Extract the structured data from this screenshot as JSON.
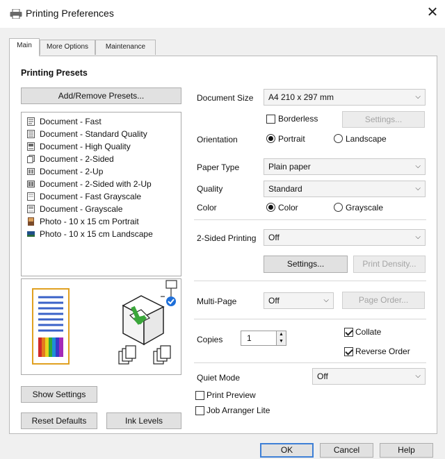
{
  "window": {
    "title": "Printing Preferences",
    "close_glyph": "✕"
  },
  "tabs": [
    {
      "label": "Main",
      "active": true
    },
    {
      "label": "More Options",
      "active": false
    },
    {
      "label": "Maintenance",
      "active": false
    }
  ],
  "presets": {
    "title": "Printing Presets",
    "add_remove_label": "Add/Remove Presets...",
    "items": [
      {
        "label": "Document - Fast",
        "icon": "document-fast-icon"
      },
      {
        "label": "Document - Standard Quality",
        "icon": "document-standard-icon"
      },
      {
        "label": "Document - High Quality",
        "icon": "document-high-quality-icon"
      },
      {
        "label": "Document - 2-Sided",
        "icon": "document-2-sided-icon"
      },
      {
        "label": "Document - 2-Up",
        "icon": "document-2-up-icon"
      },
      {
        "label": "Document - 2-Sided with 2-Up",
        "icon": "document-2-sided-2-up-icon"
      },
      {
        "label": "Document - Fast Grayscale",
        "icon": "document-fast-grayscale-icon"
      },
      {
        "label": "Document - Grayscale",
        "icon": "document-grayscale-icon"
      },
      {
        "label": "Photo - 10 x 15 cm Portrait",
        "icon": "photo-portrait-icon"
      },
      {
        "label": "Photo - 10 x 15 cm Landscape",
        "icon": "photo-landscape-icon"
      }
    ]
  },
  "left_buttons": {
    "show_settings": "Show Settings",
    "reset_defaults": "Reset Defaults",
    "ink_levels": "Ink Levels"
  },
  "settings": {
    "document_size": {
      "label": "Document Size",
      "value": "A4 210 x 297 mm"
    },
    "borderless": {
      "label": "Borderless",
      "checked": false
    },
    "borderless_settings": "Settings...",
    "orientation": {
      "label": "Orientation",
      "options": [
        "Portrait",
        "Landscape"
      ],
      "selected": "Portrait"
    },
    "paper_type": {
      "label": "Paper Type",
      "value": "Plain paper"
    },
    "quality": {
      "label": "Quality",
      "value": "Standard"
    },
    "color": {
      "label": "Color",
      "options": [
        "Color",
        "Grayscale"
      ],
      "selected": "Color"
    },
    "two_sided": {
      "label": "2-Sided Printing",
      "value": "Off"
    },
    "two_sided_settings": "Settings...",
    "print_density": "Print Density...",
    "multi_page": {
      "label": "Multi-Page",
      "value": "Off"
    },
    "page_order": "Page Order...",
    "copies": {
      "label": "Copies",
      "value": "1"
    },
    "collate": {
      "label": "Collate",
      "checked": true
    },
    "reverse_order": {
      "label": "Reverse Order",
      "checked": true
    },
    "quiet_mode": {
      "label": "Quiet Mode",
      "value": "Off"
    },
    "print_preview": {
      "label": "Print Preview",
      "checked": false
    },
    "job_arranger": {
      "label": "Job Arranger Lite",
      "checked": false
    }
  },
  "footer": {
    "ok": "OK",
    "cancel": "Cancel",
    "help": "Help"
  },
  "colors": {
    "accent": "#3d7fd6",
    "check_badge": "#1e6fd9",
    "arrow_green": "#3aa63a"
  }
}
